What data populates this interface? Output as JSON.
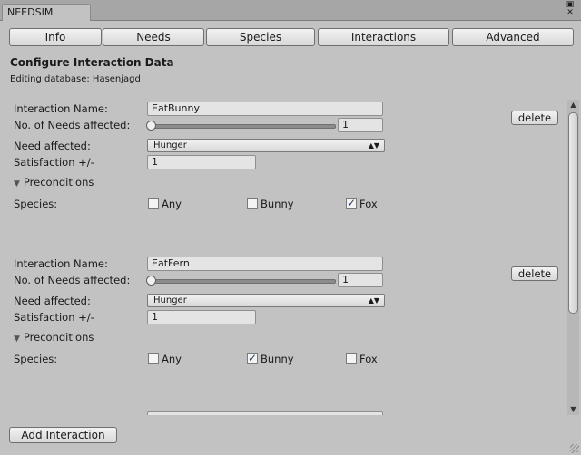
{
  "window": {
    "tab_title": "NEEDSIM"
  },
  "toolbar": {
    "tabs": [
      "Info",
      "Needs",
      "Species",
      "Interactions",
      "Advanced"
    ]
  },
  "page": {
    "heading": "Configure Interaction Data",
    "subheading": "Editing database: Hasenjagd"
  },
  "labels": {
    "interaction_name": "Interaction Name:",
    "needs_count": "No. of Needs affected:",
    "need_affected": "Need affected:",
    "satisfaction": "Satisfaction +/-",
    "preconditions": "Preconditions",
    "species": "Species:",
    "delete": "delete"
  },
  "interactions": [
    {
      "name": "EatBunny",
      "needs_affected_count": "1",
      "need_affected": "Hunger",
      "satisfaction": "1",
      "species_options": [
        {
          "label": "Any",
          "checked": false
        },
        {
          "label": "Bunny",
          "checked": false
        },
        {
          "label": "Fox",
          "checked": true
        }
      ]
    },
    {
      "name": "EatFern",
      "needs_affected_count": "1",
      "need_affected": "Hunger",
      "satisfaction": "1",
      "species_options": [
        {
          "label": "Any",
          "checked": false
        },
        {
          "label": "Bunny",
          "checked": true
        },
        {
          "label": "Fox",
          "checked": false
        }
      ]
    }
  ],
  "add_interaction_label": "Add Interaction",
  "icons": {
    "window_menu": "window-menu-icon",
    "close": "close-icon",
    "dropdown_arrow": "chevron-down-icon",
    "foldout": "triangle-down-icon",
    "check": "checkmark-icon"
  },
  "colors": {
    "background": "#c2c2c2",
    "checkmark": "#2c3e66"
  }
}
